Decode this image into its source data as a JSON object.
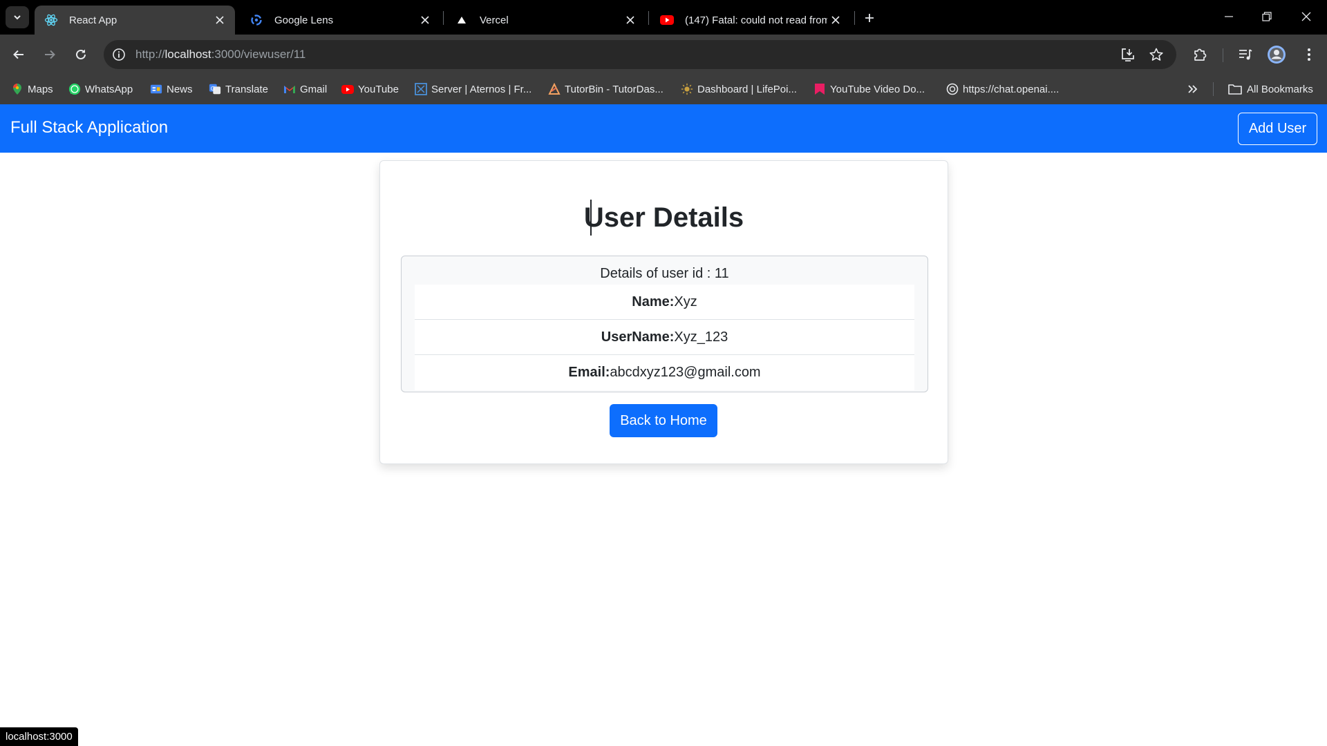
{
  "browser": {
    "tabs": [
      {
        "title": "React App",
        "active": true,
        "icon": "react-icon"
      },
      {
        "title": "Google Lens",
        "active": false,
        "icon": "google-lens-icon"
      },
      {
        "title": "Vercel",
        "active": false,
        "icon": "vercel-icon"
      },
      {
        "title": "(147) Fatal: could not read from",
        "active": false,
        "icon": "youtube-icon"
      }
    ],
    "url_scheme": "http://",
    "url_host": "localhost",
    "url_rest": ":3000/viewuser/11",
    "bookmarks": [
      {
        "label": "Maps",
        "icon": "maps-icon"
      },
      {
        "label": "WhatsApp",
        "icon": "whatsapp-icon"
      },
      {
        "label": "News",
        "icon": "news-icon"
      },
      {
        "label": "Translate",
        "icon": "translate-icon"
      },
      {
        "label": "Gmail",
        "icon": "gmail-icon"
      },
      {
        "label": "YouTube",
        "icon": "youtube-icon"
      },
      {
        "label": "Server | Aternos | Fr...",
        "icon": "aternos-icon"
      },
      {
        "label": "TutorBin - TutorDas...",
        "icon": "tutorbin-icon"
      },
      {
        "label": "Dashboard | LifePoi...",
        "icon": "lifepoints-icon"
      },
      {
        "label": "YouTube Video Do...",
        "icon": "video-download-icon"
      },
      {
        "label": "https://chat.openai....",
        "icon": "openai-icon"
      }
    ],
    "all_bookmarks": "All Bookmarks",
    "status_url": "localhost:3000",
    "colors": {
      "tabstrip": "#000000",
      "toolbar": "#3c3c3c",
      "omnibox": "#282828"
    }
  },
  "app": {
    "brand": "Full Stack Application",
    "add_user": "Add User",
    "heading": "User Details",
    "details_header": "Details of user id : 11",
    "fields": [
      {
        "label": "Name:",
        "value": "Xyz"
      },
      {
        "label": "UserName:",
        "value": "Xyz_123"
      },
      {
        "label": "Email:",
        "value": "abcdxyz123@gmail.com"
      }
    ],
    "back_button": "Back to Home",
    "colors": {
      "primary": "#0d6efd"
    }
  }
}
